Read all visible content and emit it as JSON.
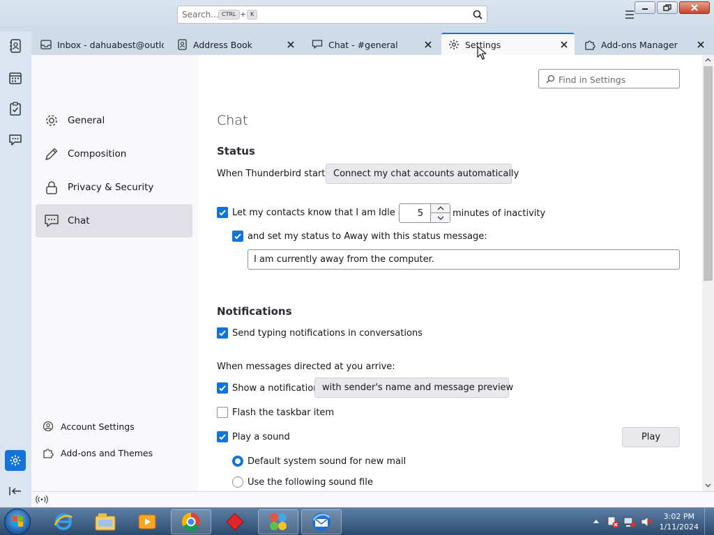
{
  "titlebar": {
    "search_placeholder": "Search...",
    "shortcut_key1": "CTRL",
    "shortcut_plus": "+",
    "shortcut_key2": "K"
  },
  "tabs": [
    {
      "label": "Inbox - dahuabest@outlook.com",
      "icon": "inbox-icon",
      "active": false
    },
    {
      "label": "Address Book",
      "icon": "address-book-icon",
      "active": false
    },
    {
      "label": "Chat - #general",
      "icon": "chat-icon",
      "active": false
    },
    {
      "label": "Settings",
      "icon": "gear-icon",
      "active": true
    },
    {
      "label": "Add-ons Manager",
      "icon": "puzzle-icon",
      "active": false
    }
  ],
  "spaces": [
    "mail-icon",
    "address-book-icon",
    "calendar-icon",
    "tasks-icon",
    "chat-icon",
    "settings-icon",
    "collapse-icon"
  ],
  "sidebar": {
    "categories": [
      {
        "label": "General",
        "icon": "gear-icon"
      },
      {
        "label": "Composition",
        "icon": "pencil-icon"
      },
      {
        "label": "Privacy & Security",
        "icon": "lock-icon"
      },
      {
        "label": "Chat",
        "icon": "chat-icon",
        "selected": true
      }
    ],
    "links": [
      {
        "label": "Account Settings",
        "icon": "account-icon"
      },
      {
        "label": "Add-ons and Themes",
        "icon": "puzzle-icon"
      }
    ]
  },
  "content": {
    "find_placeholder": "Find in Settings",
    "page_title": "Chat",
    "status": {
      "heading": "Status",
      "startup_label": "When Thunderbird starts:",
      "startup_value": "Connect my chat accounts automatically",
      "idle_label_before": "Let my contacts know that I am Idle after",
      "idle_minutes": "5",
      "idle_label_after": "minutes of inactivity",
      "idle_checked": true,
      "away_label": "and set my status to Away with this status message:",
      "away_checked": true,
      "away_message": "I am currently away from the computer."
    },
    "notifications": {
      "heading": "Notifications",
      "typing_label": "Send typing notifications in conversations",
      "typing_checked": true,
      "arrive_label": "When messages directed at you arrive:",
      "show_notification_label": "Show a notification",
      "show_notification_checked": true,
      "notification_mode": "with sender's name and message preview",
      "flash_label": "Flash the taskbar item",
      "flash_checked": false,
      "play_sound_label": "Play a sound",
      "play_sound_checked": true,
      "play_button": "Play",
      "sound_options": [
        {
          "label": "Default system sound for new mail",
          "selected": true
        },
        {
          "label": "Use the following sound file",
          "selected": false
        }
      ]
    }
  },
  "taskbar": {
    "time": "3:02 PM",
    "date": "1/11/2024"
  },
  "colors": {
    "accent": "#1373d9",
    "titlebar": "#cfdbe9"
  }
}
